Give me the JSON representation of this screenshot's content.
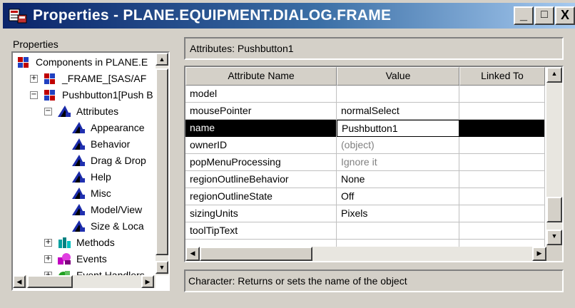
{
  "window": {
    "title": "Properties - PLANE.EQUIPMENT.DIALOG.FRAME",
    "minimize_glyph": "_",
    "maximize_glyph": "□",
    "close_glyph": "X"
  },
  "tree": {
    "label": "Properties",
    "items": [
      {
        "label": "Components in PLANE.E",
        "icon": "components-icon",
        "expander": ""
      },
      {
        "label": "_FRAME_[SAS/AF",
        "icon": "frame-icon",
        "expander": "+"
      },
      {
        "label": "Pushbutton1[Push B",
        "icon": "pushbutton-icon",
        "expander": "−"
      },
      {
        "label": "Attributes",
        "icon": "attributes-icon",
        "expander": "−"
      },
      {
        "label": "Appearance",
        "icon": "attribute-category-icon",
        "expander": ""
      },
      {
        "label": "Behavior",
        "icon": "attribute-category-icon",
        "expander": ""
      },
      {
        "label": "Drag & Drop",
        "icon": "attribute-category-icon",
        "expander": ""
      },
      {
        "label": "Help",
        "icon": "attribute-category-icon",
        "expander": ""
      },
      {
        "label": "Misc",
        "icon": "attribute-category-icon",
        "expander": ""
      },
      {
        "label": "Model/View",
        "icon": "attribute-category-icon",
        "expander": ""
      },
      {
        "label": "Size & Loca",
        "icon": "attribute-category-icon",
        "expander": ""
      },
      {
        "label": "Methods",
        "icon": "methods-icon",
        "expander": "+"
      },
      {
        "label": "Events",
        "icon": "events-icon",
        "expander": "+"
      },
      {
        "label": "Event Handlers",
        "icon": "event-handlers-icon",
        "expander": "+"
      }
    ]
  },
  "attributes": {
    "header": "Attributes: Pushbutton1",
    "columns": [
      "Attribute Name",
      "Value",
      "Linked To"
    ],
    "rows": [
      {
        "name": "model",
        "value": "",
        "linked": "",
        "dim": false
      },
      {
        "name": "mousePointer",
        "value": "normalSelect",
        "linked": "",
        "dim": false
      },
      {
        "name": "name",
        "value": "Pushbutton1",
        "linked": "",
        "dim": false
      },
      {
        "name": "ownerID",
        "value": "(object)",
        "linked": "",
        "dim": true
      },
      {
        "name": "popMenuProcessing",
        "value": "Ignore it",
        "linked": "",
        "dim": true
      },
      {
        "name": "regionOutlineBehavior",
        "value": "None",
        "linked": "",
        "dim": false
      },
      {
        "name": "regionOutlineState",
        "value": "Off",
        "linked": "",
        "dim": false
      },
      {
        "name": "sizingUnits",
        "value": "Pixels",
        "linked": "",
        "dim": false
      },
      {
        "name": "toolTipText",
        "value": "",
        "linked": "",
        "dim": false
      }
    ],
    "selected_row": "name"
  },
  "description": "Character: Returns or sets the name of the object",
  "colors": {
    "titlebar_start": "#0a246a",
    "titlebar_end": "#a6caf0",
    "face": "#d4d0c8",
    "selection": "#000000",
    "dim_text": "#808080"
  }
}
